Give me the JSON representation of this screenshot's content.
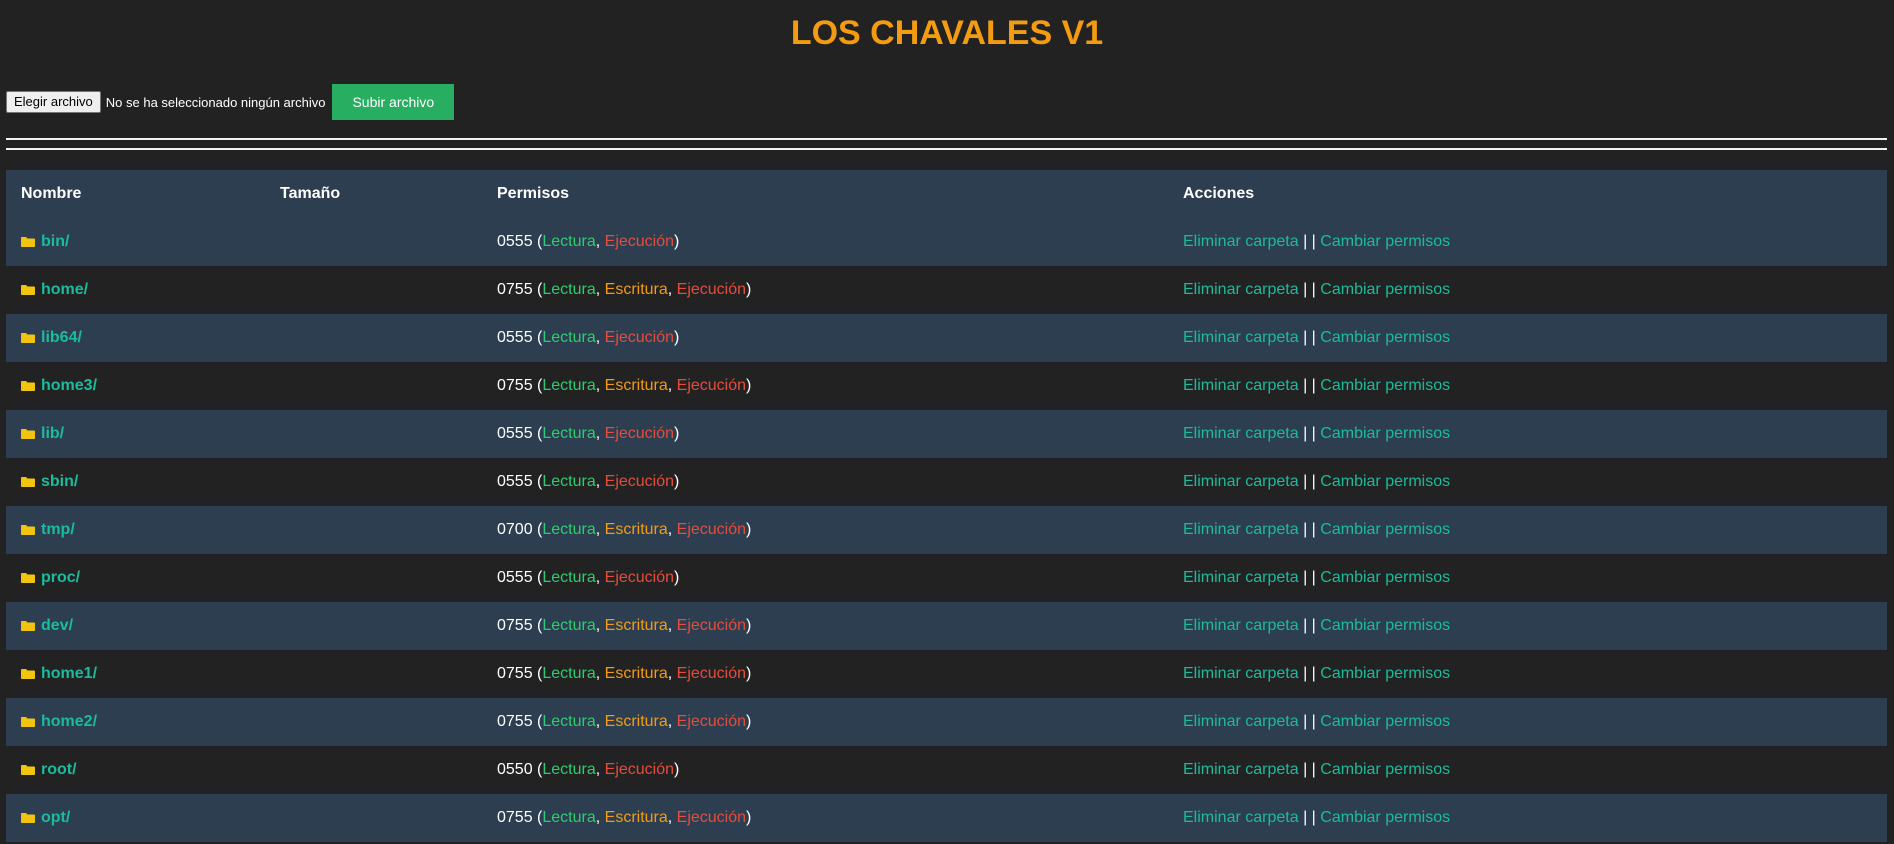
{
  "header": {
    "title": "LOS CHAVALES V1"
  },
  "upload": {
    "choose_label": "Elegir archivo",
    "status": "No se ha seleccionado ningún archivo",
    "submit_label": "Subir archivo"
  },
  "table": {
    "columns": [
      "Nombre",
      "Tamaño",
      "Permisos",
      "Acciones"
    ],
    "rows": [
      {
        "name": "bin/",
        "size": "",
        "mode": "0555",
        "perms": [
          "Lectura",
          "Ejecución"
        ]
      },
      {
        "name": "home/",
        "size": "",
        "mode": "0755",
        "perms": [
          "Lectura",
          "Escritura",
          "Ejecución"
        ]
      },
      {
        "name": "lib64/",
        "size": "",
        "mode": "0555",
        "perms": [
          "Lectura",
          "Ejecución"
        ]
      },
      {
        "name": "home3/",
        "size": "",
        "mode": "0755",
        "perms": [
          "Lectura",
          "Escritura",
          "Ejecución"
        ]
      },
      {
        "name": "lib/",
        "size": "",
        "mode": "0555",
        "perms": [
          "Lectura",
          "Ejecución"
        ]
      },
      {
        "name": "sbin/",
        "size": "",
        "mode": "0555",
        "perms": [
          "Lectura",
          "Ejecución"
        ]
      },
      {
        "name": "tmp/",
        "size": "",
        "mode": "0700",
        "perms": [
          "Lectura",
          "Escritura",
          "Ejecución"
        ]
      },
      {
        "name": "proc/",
        "size": "",
        "mode": "0555",
        "perms": [
          "Lectura",
          "Ejecución"
        ]
      },
      {
        "name": "dev/",
        "size": "",
        "mode": "0755",
        "perms": [
          "Lectura",
          "Escritura",
          "Ejecución"
        ]
      },
      {
        "name": "home1/",
        "size": "",
        "mode": "0755",
        "perms": [
          "Lectura",
          "Escritura",
          "Ejecución"
        ]
      },
      {
        "name": "home2/",
        "size": "",
        "mode": "0755",
        "perms": [
          "Lectura",
          "Escritura",
          "Ejecución"
        ]
      },
      {
        "name": "root/",
        "size": "",
        "mode": "0550",
        "perms": [
          "Lectura",
          "Ejecución"
        ]
      },
      {
        "name": "opt/",
        "size": "",
        "mode": "0755",
        "perms": [
          "Lectura",
          "Escritura",
          "Ejecución"
        ]
      }
    ],
    "actions": {
      "delete_label": "Eliminar carpeta",
      "separator": "| |",
      "chmod_label": "Cambiar permisos"
    }
  },
  "icons": {
    "folder": "folder-icon"
  },
  "colors": {
    "background": "#222222",
    "header_row": "#2c3e50",
    "title": "#f39c12",
    "link": "#1abc9c",
    "read": "#2ecc71",
    "write": "#f39c12",
    "exec": "#e74c3c",
    "folder": "#f1c40f",
    "upload_button": "#27ae60"
  }
}
